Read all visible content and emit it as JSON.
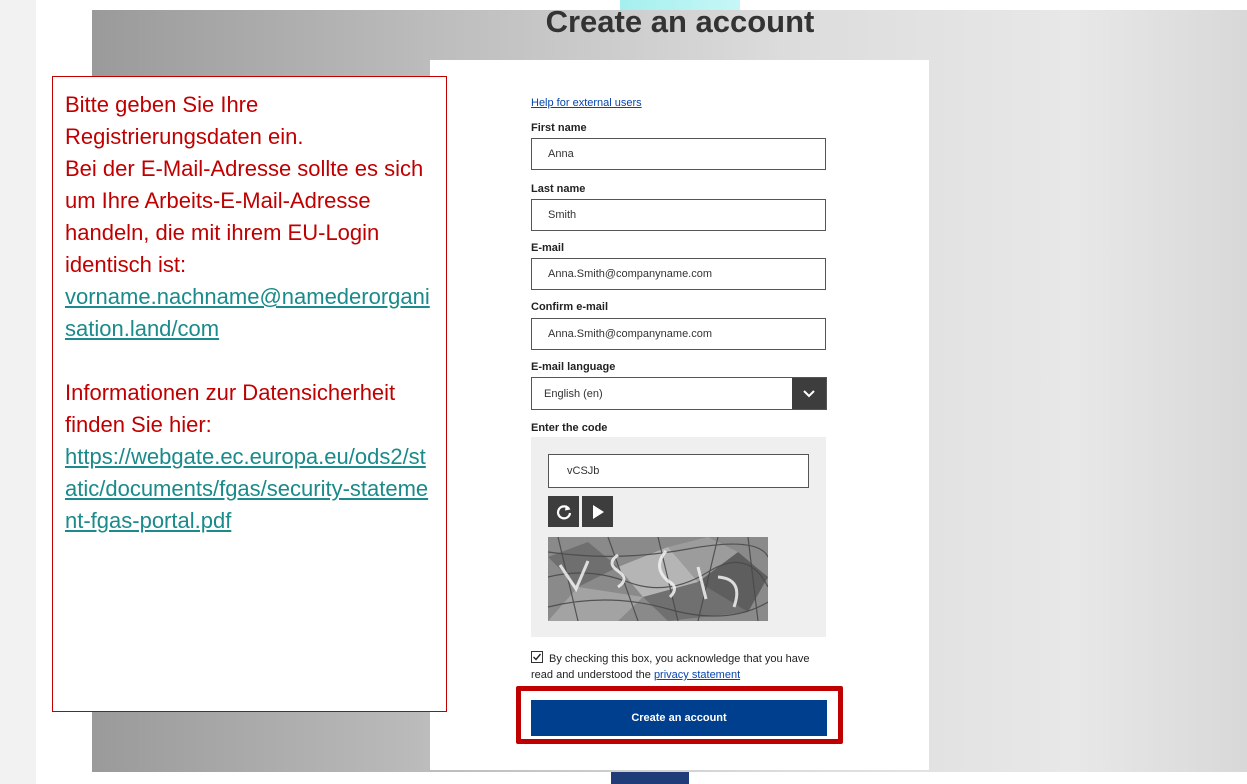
{
  "page_title": "Create an account",
  "form": {
    "help_link": "Help for external users",
    "first_name": {
      "label": "First name",
      "value": "Anna"
    },
    "last_name": {
      "label": "Last name",
      "value": "Smith"
    },
    "email": {
      "label": "E-mail",
      "value": "Anna.Smith@companyname.com"
    },
    "confirm_email": {
      "label": "Confirm e-mail",
      "value": "Anna.Smith@companyname.com"
    },
    "email_language": {
      "label": "E-mail language",
      "selected": "English (en)"
    },
    "captcha": {
      "label": "Enter the code",
      "value": "vCSJb",
      "refresh_icon": "refresh-icon",
      "play_icon": "play-icon"
    },
    "consent": {
      "checked": true,
      "text": "By checking this box, you acknowledge that you have read and understood the",
      "link": "privacy statement"
    },
    "submit_label": "Create an account"
  },
  "callout": {
    "line1": "Bitte geben Sie Ihre Registrierungsdaten ein.",
    "line2": "Bei der E-Mail-Adresse sollte es sich um Ihre Arbeits-E-Mail-Adresse handeln, die mit ihrem EU-Login identisch ist:",
    "email_link": "vorname.nachname@namederorganisation.land/com",
    "line3": "Informationen zur Datensicherheit finden Sie hier:",
    "url_link": "https://webgate.ec.europa.eu/ods2/static/documents/fgas/security-statement-fgas-portal.pdf"
  },
  "colors": {
    "callout_text": "#c00000",
    "callout_link": "#1a8a8a",
    "submit_button": "#003f8e",
    "highlight_border": "#c00000"
  }
}
